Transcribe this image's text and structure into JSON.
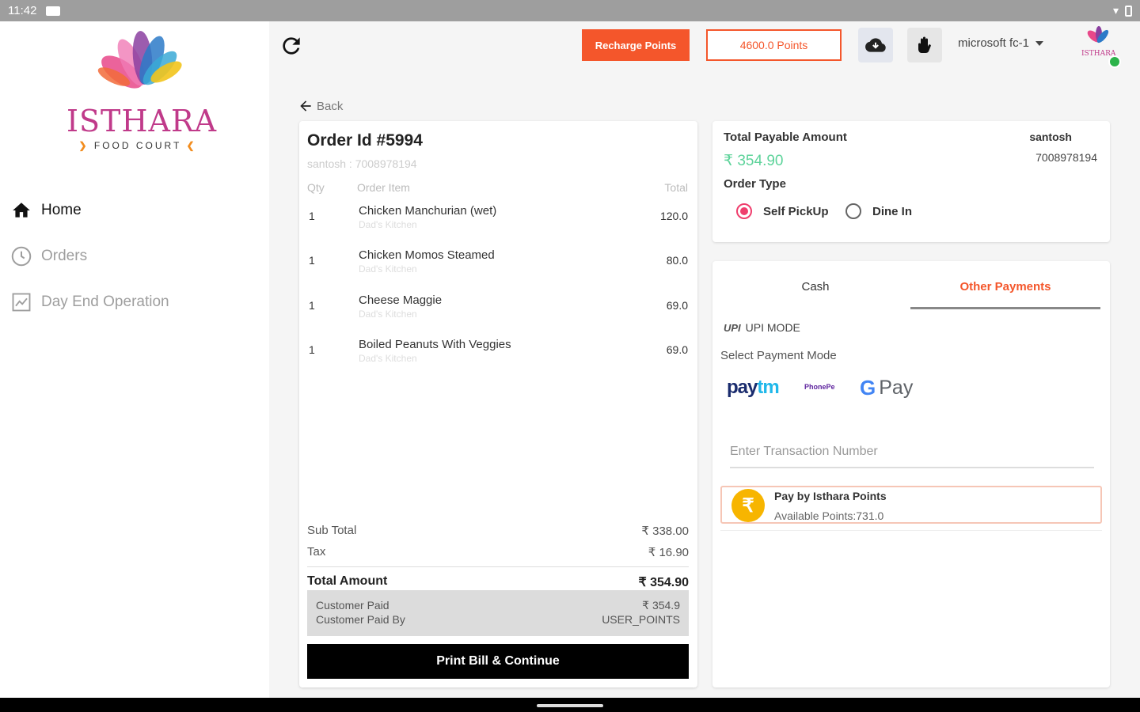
{
  "status_bar": {
    "time": "11:42"
  },
  "brand": {
    "name": "ISTHARA",
    "tagline": "FOOD COURT"
  },
  "sidebar": {
    "items": [
      {
        "label": "Home",
        "icon": "home-icon",
        "active": true
      },
      {
        "label": "Orders",
        "icon": "history-icon",
        "active": false
      },
      {
        "label": "Day End Operation",
        "icon": "chart-icon",
        "active": false
      }
    ]
  },
  "header": {
    "recharge_label": "Recharge Points",
    "points_label": "4600.0 Points",
    "user_name": "microsoft fc-1",
    "accent_color": "#f4562b"
  },
  "back_label": "Back",
  "order": {
    "title": "Order Id #5994",
    "customer_line": "santosh : 7008978194",
    "headers": {
      "qty": "Qty",
      "item": "Order Item",
      "total": "Total"
    },
    "items": [
      {
        "qty": "1",
        "name": "Chicken Manchurian (wet)",
        "kitchen": "Dad's Kitchen",
        "total": "120.0"
      },
      {
        "qty": "1",
        "name": "Chicken Momos Steamed",
        "kitchen": "Dad's Kitchen",
        "total": "80.0"
      },
      {
        "qty": "1",
        "name": "Cheese Maggie",
        "kitchen": "Dad's Kitchen",
        "total": "69.0"
      },
      {
        "qty": "1",
        "name": "Boiled Peanuts With Veggies",
        "kitchen": "Dad's Kitchen",
        "total": "69.0"
      }
    ],
    "subtotal_label": "Sub Total",
    "subtotal_value": "₹ 338.00",
    "tax_label": "Tax",
    "tax_value": "₹ 16.90",
    "total_label": "Total Amount",
    "total_value": "₹ 354.90",
    "paid_label": "Customer Paid",
    "paid_value": "₹ 354.9",
    "paid_by_label": "Customer Paid By",
    "paid_by_value": "USER_POINTS",
    "print_label": "Print Bill & Continue"
  },
  "payable": {
    "label": "Total Payable Amount",
    "amount": "₹ 354.90",
    "order_type_label": "Order Type",
    "customer_name": "santosh",
    "customer_phone": "7008978194",
    "options": [
      {
        "label": "Self PickUp",
        "selected": true
      },
      {
        "label": "Dine In",
        "selected": false
      }
    ]
  },
  "payment": {
    "tabs": [
      {
        "label": "Cash",
        "active": false
      },
      {
        "label": "Other Payments",
        "active": true
      }
    ],
    "upi_logo": "UPI",
    "upi_label": "UPI MODE",
    "select_mode_label": "Select Payment Mode",
    "providers": {
      "paytm_a": "pay",
      "paytm_b": "tm",
      "phonepe": "PhonePe",
      "gpay_g": "G",
      "gpay_text": "Pay"
    },
    "txn_placeholder": "Enter Transaction Number",
    "isthara_title": "Pay by Isthara Points",
    "isthara_available": "Available Points:731.0",
    "coin_symbol": "₹"
  }
}
